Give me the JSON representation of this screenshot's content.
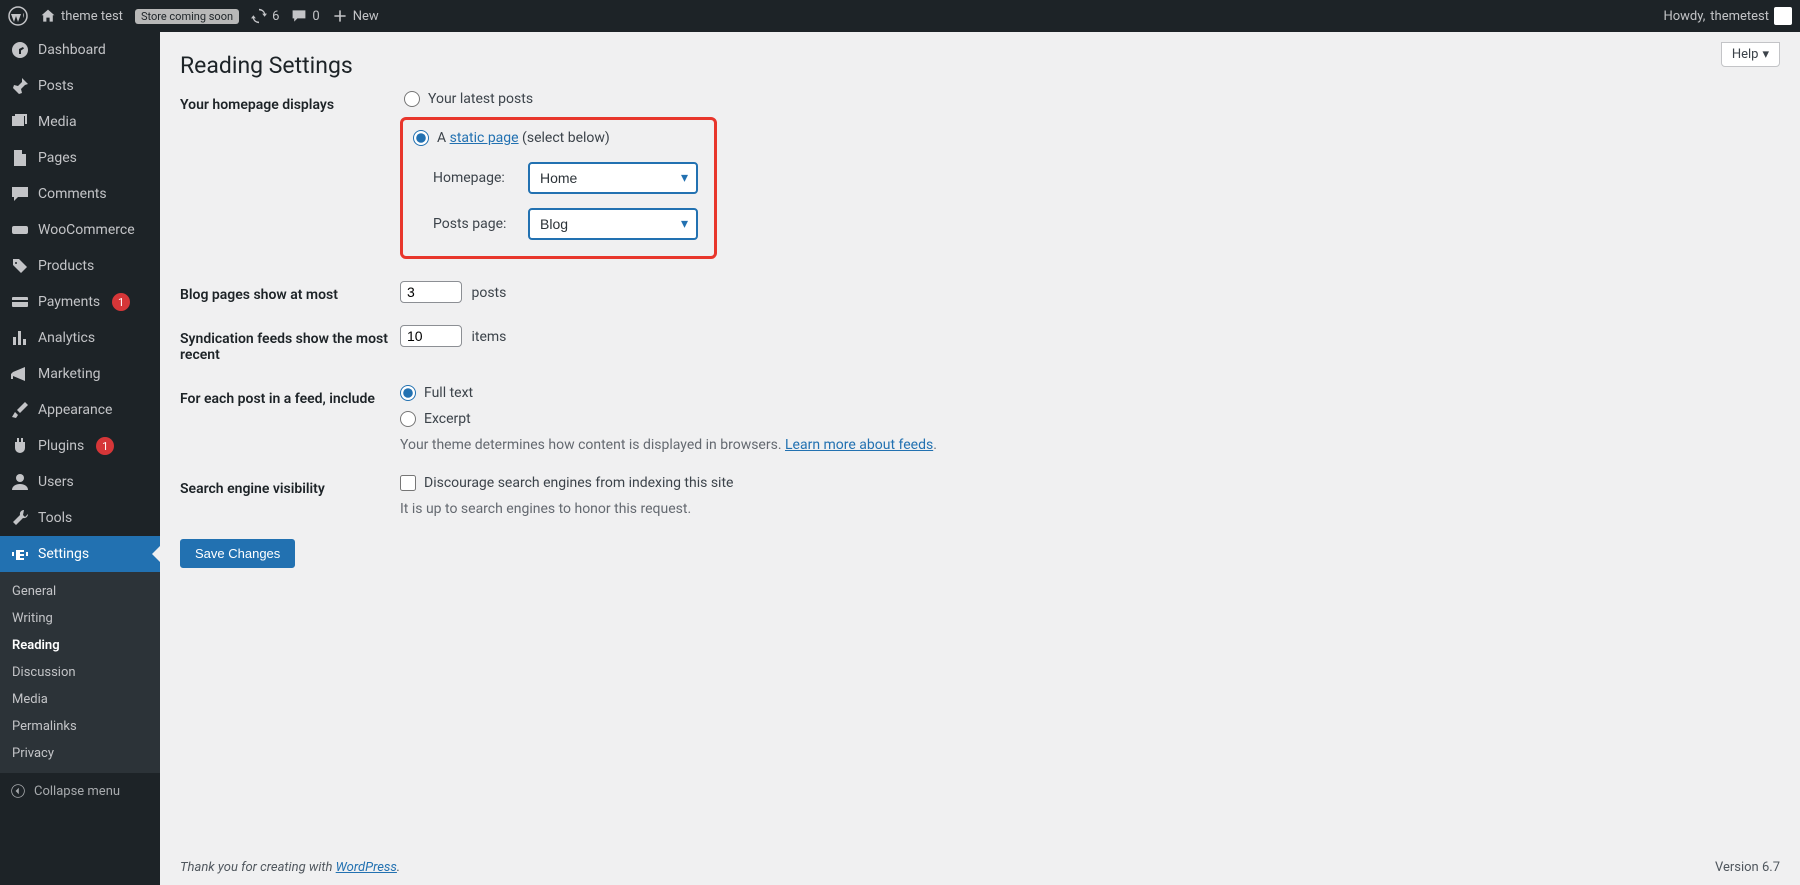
{
  "adminbar": {
    "site_name": "theme test",
    "store_badge": "Store coming soon",
    "updates_count": "6",
    "comments_count": "0",
    "new_label": "New",
    "howdy_prefix": "Howdy, ",
    "user_name": "themetest"
  },
  "sidebar": {
    "dashboard": "Dashboard",
    "posts": "Posts",
    "media": "Media",
    "pages": "Pages",
    "comments": "Comments",
    "woocommerce": "WooCommerce",
    "products": "Products",
    "payments": "Payments",
    "payments_badge": "1",
    "analytics": "Analytics",
    "marketing": "Marketing",
    "appearance": "Appearance",
    "plugins": "Plugins",
    "plugins_badge": "1",
    "users": "Users",
    "tools": "Tools",
    "settings": "Settings",
    "collapse": "Collapse menu"
  },
  "submenu": {
    "general": "General",
    "writing": "Writing",
    "reading": "Reading",
    "discussion": "Discussion",
    "media": "Media",
    "permalinks": "Permalinks",
    "privacy": "Privacy"
  },
  "page": {
    "help_label": "Help",
    "title": "Reading Settings",
    "homepage_label": "Your homepage displays",
    "latest_posts": "Your latest posts",
    "static_prefix": "A ",
    "static_link": "static page",
    "static_suffix": " (select below)",
    "homepage_select_label": "Homepage:",
    "homepage_value": "Home",
    "posts_page_label": "Posts page:",
    "posts_page_value": "Blog",
    "blog_pages_label": "Blog pages show at most",
    "blog_pages_value": "3",
    "posts_suffix": "posts",
    "syndication_label": "Syndication feeds show the most recent",
    "syndication_value": "10",
    "items_suffix": "items",
    "feed_include_label": "For each post in a feed, include",
    "full_text": "Full text",
    "excerpt": "Excerpt",
    "feed_desc_prefix": "Your theme determines how content is displayed in browsers. ",
    "feed_desc_link": "Learn more about feeds",
    "feed_desc_suffix": ".",
    "search_visibility_label": "Search engine visibility",
    "discourage_label": "Discourage search engines from indexing this site",
    "discourage_desc": "It is up to search engines to honor this request.",
    "save_button": "Save Changes"
  },
  "footer": {
    "thank_prefix": "Thank you for creating with ",
    "wp_link": "WordPress",
    "thank_suffix": ".",
    "version": "Version 6.7"
  }
}
